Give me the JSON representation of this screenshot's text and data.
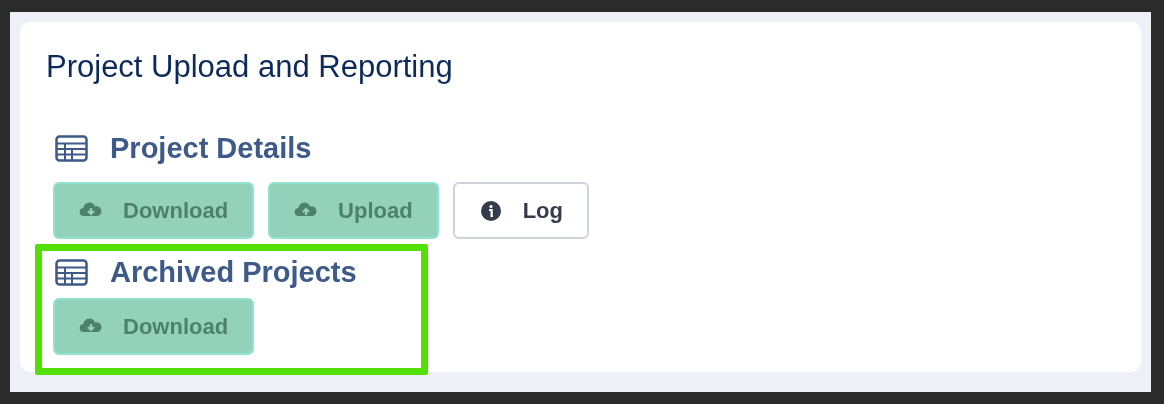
{
  "card": {
    "title": "Project Upload and Reporting"
  },
  "sections": [
    {
      "heading": "Project Details",
      "highlighted": false,
      "buttons": [
        {
          "label": "Download",
          "kind": "download"
        },
        {
          "label": "Upload",
          "kind": "upload"
        },
        {
          "label": "Log",
          "kind": "info"
        }
      ]
    },
    {
      "heading": "Archived Projects",
      "highlighted": true,
      "buttons": [
        {
          "label": "Download",
          "kind": "download"
        }
      ]
    }
  ]
}
